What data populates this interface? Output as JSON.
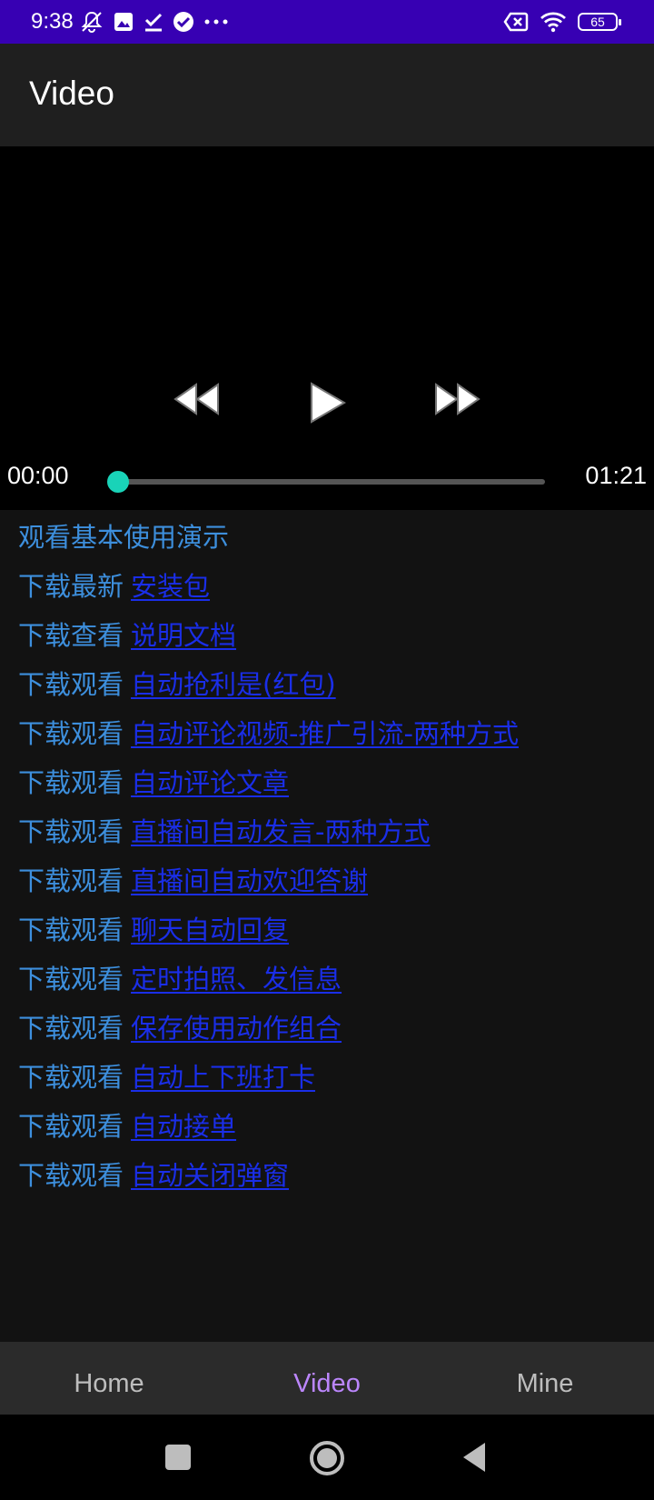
{
  "status_bar": {
    "time": "9:38",
    "battery": "65",
    "left_icons": [
      "muted-icon",
      "image-icon",
      "check-icon",
      "verified-icon",
      "more-icon"
    ],
    "right_icons": [
      "sim-off-icon",
      "wifi-icon",
      "battery-icon"
    ]
  },
  "app_bar": {
    "title": "Video"
  },
  "player": {
    "current_time": "00:00",
    "total_time": "01:21",
    "progress": 0.02,
    "accent_color": "#19d3b8"
  },
  "links": {
    "prefix_color": "#3d8fdd",
    "link_color": "#1a2ee8",
    "items": [
      {
        "prefix": "观看基本使用演示",
        "link": ""
      },
      {
        "prefix": "下载最新",
        "link": "安装包"
      },
      {
        "prefix": "下载查看",
        "link": "说明文档"
      },
      {
        "prefix": "下载观看",
        "link": "自动抢利是(红包)"
      },
      {
        "prefix": "下载观看",
        "link": "自动评论视频-推广引流-两种方式"
      },
      {
        "prefix": "下载观看",
        "link": "自动评论文章"
      },
      {
        "prefix": "下载观看",
        "link": "直播间自动发言-两种方式"
      },
      {
        "prefix": "下载观看",
        "link": "直播间自动欢迎答谢"
      },
      {
        "prefix": "下载观看",
        "link": "聊天自动回复"
      },
      {
        "prefix": "下载观看",
        "link": "定时拍照、发信息"
      },
      {
        "prefix": "下载观看",
        "link": "保存使用动作组合"
      },
      {
        "prefix": "下载观看",
        "link": "自动上下班打卡"
      },
      {
        "prefix": "下载观看",
        "link": "自动接单"
      },
      {
        "prefix": "下载观看",
        "link": "自动关闭弹窗"
      }
    ]
  },
  "bottom_nav": {
    "active_color": "#bb86fc",
    "items": [
      {
        "label": "Home",
        "active": false
      },
      {
        "label": "Video",
        "active": true
      },
      {
        "label": "Mine",
        "active": false
      }
    ]
  },
  "system_nav": [
    "recents-icon",
    "home-icon",
    "back-icon"
  ]
}
